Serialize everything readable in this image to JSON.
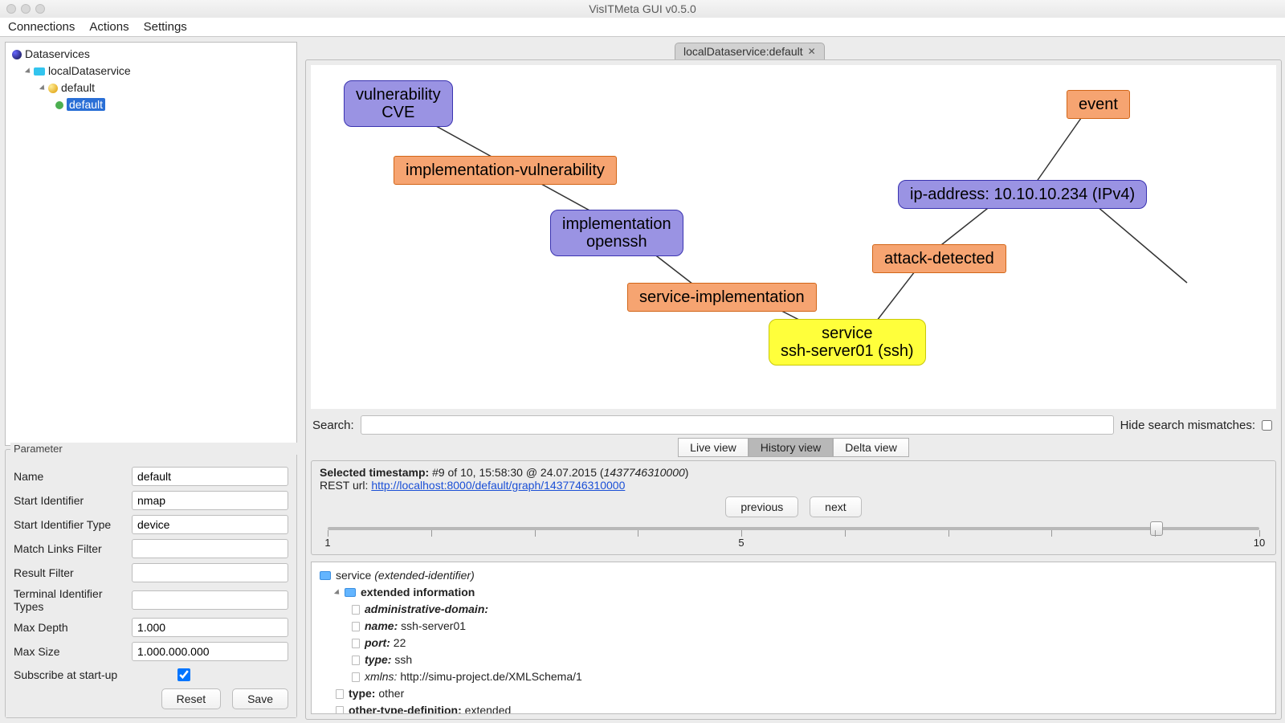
{
  "window": {
    "title": "VisITMeta GUI v0.5.0"
  },
  "menubar": {
    "connections": "Connections",
    "actions": "Actions",
    "settings": "Settings"
  },
  "tree": {
    "root": "Dataservices",
    "local": "localDataservice",
    "default1": "default",
    "default2": "default"
  },
  "parameter": {
    "legend": "Parameter",
    "name_lbl": "Name",
    "name_val": "default",
    "start_id_lbl": "Start Identifier",
    "start_id_val": "nmap",
    "start_type_lbl": "Start Identifier Type",
    "start_type_val": "device",
    "match_links_lbl": "Match Links Filter",
    "match_links_val": "",
    "result_filter_lbl": "Result Filter",
    "result_filter_val": "",
    "terminal_lbl": "Terminal Identifier Types",
    "terminal_val": "",
    "maxdepth_lbl": "Max Depth",
    "maxdepth_val": "1.000",
    "maxsize_lbl": "Max Size",
    "maxsize_val": "1.000.000.000",
    "subscribe_lbl": "Subscribe at start-up",
    "reset_btn": "Reset",
    "save_btn": "Save"
  },
  "tab": {
    "label": "localDataservice:default"
  },
  "graph": {
    "vuln1": "vulnerability",
    "vuln2": "CVE",
    "impl_vuln": "implementation-vulnerability",
    "impl1": "implementation",
    "impl2": "openssh",
    "service_impl": "service-implementation",
    "svc1": "service",
    "svc2": "ssh-server01 (ssh)",
    "ip": "ip-address: 10.10.10.234 (IPv4)",
    "event": "event",
    "attack": "attack-detected"
  },
  "search": {
    "label": "Search:",
    "hide_label": "Hide search mismatches:"
  },
  "viewtabs": {
    "live": "Live view",
    "history": "History view",
    "delta": "Delta view"
  },
  "info": {
    "sel_ts_lbl": "Selected timestamp:",
    "sel_ts_val": "#9 of 10, 15:58:30 @ 24.07.2015 (",
    "sel_ts_epoch": "1437746310000",
    "sel_ts_close": ")",
    "rest_lbl": "REST url: ",
    "rest_url": "http://localhost:8000/default/graph/1437746310000",
    "prev": "previous",
    "next": "next",
    "slider_min": "1",
    "slider_mid": "5",
    "slider_max": "10"
  },
  "details": {
    "svc_lbl": "service",
    "svc_hint": "(extended-identifier)",
    "ext_info": "extended information",
    "ad_lbl": "administrative-domain:",
    "name_lbl": "name:",
    "name_val": "ssh-server01",
    "port_lbl": "port:",
    "port_val": "22",
    "type_lbl": "type:",
    "type_val": "ssh",
    "xmlns_lbl": "xmlns:",
    "xmlns_val": "http://simu-project.de/XMLSchema/1",
    "toptype_lbl": "type:",
    "toptype_val": "other",
    "otd_lbl": "other-type-definition:",
    "otd_val": "extended"
  }
}
